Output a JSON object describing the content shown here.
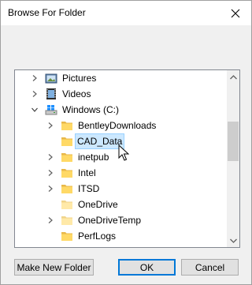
{
  "window": {
    "title": "Browse For Folder"
  },
  "tree": {
    "items": [
      {
        "label": "Pictures",
        "icon": "pictures-folder-icon",
        "expander": "collapsed"
      },
      {
        "label": "Videos",
        "icon": "videos-folder-icon",
        "expander": "collapsed"
      },
      {
        "label": "Windows (C:)",
        "icon": "windows-drive-icon",
        "expander": "expanded"
      },
      {
        "label": "BentleyDownloads",
        "icon": "folder-icon",
        "expander": "collapsed"
      },
      {
        "label": "CAD_Data",
        "icon": "folder-icon",
        "expander": "none",
        "selected": true
      },
      {
        "label": "inetpub",
        "icon": "folder-icon",
        "expander": "collapsed"
      },
      {
        "label": "Intel",
        "icon": "folder-icon",
        "expander": "collapsed"
      },
      {
        "label": "ITSD",
        "icon": "folder-icon",
        "expander": "collapsed"
      },
      {
        "label": "OneDrive",
        "icon": "folder-icon",
        "expander": "none"
      },
      {
        "label": "OneDriveTemp",
        "icon": "folder-icon",
        "expander": "collapsed"
      },
      {
        "label": "PerfLogs",
        "icon": "folder-icon",
        "expander": "none"
      }
    ]
  },
  "buttons": {
    "make_new_folder": "Make New Folder",
    "ok": "OK",
    "cancel": "Cancel"
  },
  "colors": {
    "selection_bg": "#cce8ff",
    "selection_border": "#99d1ff",
    "folder_yellow": "#ffd966",
    "default_button_border": "#0078d7"
  }
}
